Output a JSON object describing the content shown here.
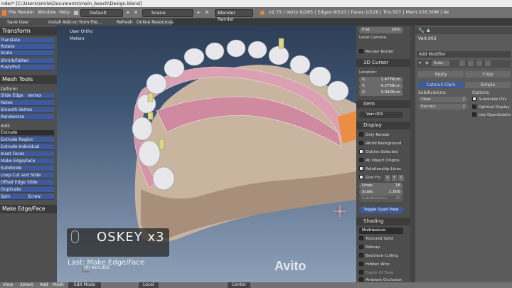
{
  "window": {
    "title": "nder* [C:\\Users\\smile\\Documents\\main_beach\\Design.blend]"
  },
  "menu": {
    "items": [
      "File",
      "Render",
      "Window",
      "Help"
    ],
    "screen_layout": "Default",
    "scene": "Scene",
    "render_engine": "Blender Render",
    "stats": "v2.79 | Verts:9/285 | Edges:9/510 | Faces:1/226 | Tris:507 | Mem:226.50M | Ve"
  },
  "toolbar2": {
    "save_user_settings": "Save User Settings",
    "install_addon": "Install Add-on from File...",
    "refresh": "Refresh",
    "online_resources": "Online Resources"
  },
  "tool_shelf": {
    "transform_header": "Transform",
    "transform_buttons": [
      "Translate",
      "Rotate",
      "Scale",
      "Shrink/Fatten",
      "Push/Pull"
    ],
    "mesh_tools_header": "Mesh Tools",
    "deform_label": "Deform:",
    "slide_edge": "Slide Edge",
    "vertex": "Vertex",
    "deform_buttons": [
      "Noise",
      "Smooth Vertex",
      "Randomize"
    ],
    "add_label": "Add:",
    "extrude": "Extrude",
    "add_buttons": [
      "Extrude Region",
      "Extrude Individual",
      "Inset Faces",
      "Make Edge/Face",
      "Subdivide",
      "Loop Cut and Slide",
      "Offset Edge Slide",
      "Duplicate"
    ],
    "spin": "Spin",
    "screw": "Screw",
    "last_op_header": "Make Edge/Face"
  },
  "viewport": {
    "view_label": "User Ortho",
    "units_label": "Meters",
    "key_overlay": "OSKEY x3",
    "last_operator": "Last: Make Edge/Face",
    "object_info": "(0) Vert.003",
    "watermark": "Avito"
  },
  "properties": {
    "end_label": "End:",
    "end_value": "10m",
    "local_camera": "Local Camera:",
    "render_border": "Render Border",
    "cursor_header": "3D Cursor",
    "location_label": "Location:",
    "cursor_x_label": "X:",
    "cursor_x": "1.4776cm",
    "cursor_y_label": "Y:",
    "cursor_y": "4.2758cm",
    "cursor_z_label": "Z:",
    "cursor_z": "3.0426cm",
    "item_header": "Item",
    "item_name": "Vert.003",
    "display_header": "Display",
    "display_options": [
      {
        "label": "Only Render",
        "on": false
      },
      {
        "label": "World Background",
        "on": false
      },
      {
        "label": "Outline Selected",
        "on": true
      },
      {
        "label": "All Object Origins",
        "on": false
      },
      {
        "label": "Relationship Lines",
        "on": true
      }
    ],
    "grid_floor": "Grid Flo",
    "axes": [
      "X",
      "Y",
      "Z"
    ],
    "lines_label": "Lines:",
    "lines_value": "16",
    "scale_label": "Scale:",
    "scale_value": "1.000",
    "subdivisions_label": "Subdivisions:",
    "subdivisions_value": "10",
    "toggle_quad": "Toggle Quad View",
    "shading_header": "Shading",
    "shading_mode": "Multitexture",
    "shading_options": [
      {
        "label": "Textured Solid",
        "on": false
      },
      {
        "label": "Matcap",
        "on": false
      },
      {
        "label": "Backface Culling",
        "on": false
      },
      {
        "label": "Hidden Wire",
        "on": false
      },
      {
        "label": "Depth Of Field",
        "on": false
      },
      {
        "label": "Ambient Occlusion",
        "on": false
      }
    ]
  },
  "modifier_panel": {
    "object_name": "Vert.003",
    "add_modifier": "Add Modifier",
    "modifier_short": "Subs",
    "apply": "Apply",
    "copy": "Copy",
    "tab_catmull": "Catmull-Clark",
    "tab_simple": "Simple",
    "subdivisions_label": "Subdivisions:",
    "view_label": "View:",
    "view_value": "2",
    "render_label": "Render:",
    "render_value": "2",
    "options_label": "Options:",
    "options": [
      {
        "label": "Subdivide UVs",
        "on": true
      },
      {
        "label": "Optimal Display",
        "on": false
      },
      {
        "label": "Use OpenSubdiv",
        "on": false
      }
    ]
  },
  "bottom_bar": {
    "view": "View",
    "select": "Select",
    "add": "Add",
    "mesh": "Mesh",
    "mode": "Edit Mode",
    "orientation": "Local",
    "pivot": "Center"
  },
  "colors": {
    "accent_blue": "#3d5a9a",
    "selected_orange": "#f08a36",
    "gum_pink": "#d9a0b0"
  }
}
